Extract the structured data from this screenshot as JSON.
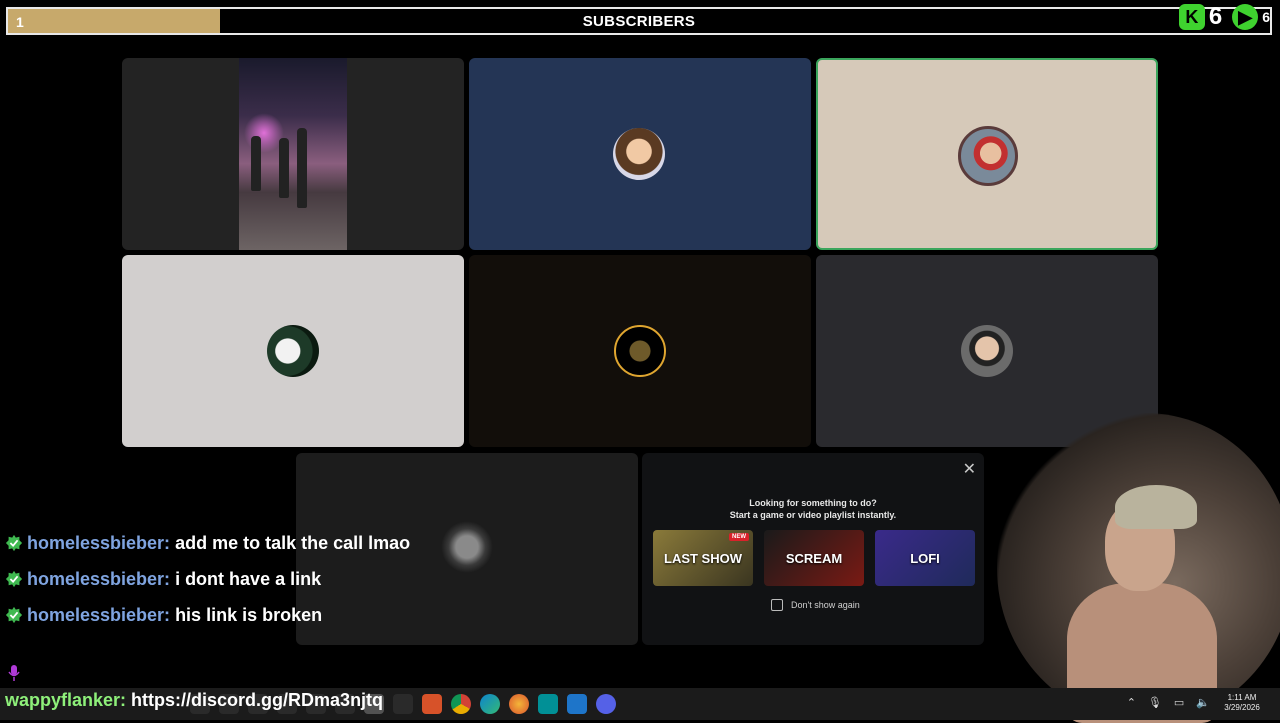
{
  "subscriber_bar": {
    "count": "1",
    "title": "SUBSCRIBERS",
    "progress_fraction": 0.168,
    "kick_count": "6",
    "rumble_count": "6"
  },
  "call": {
    "tiles": [
      {
        "name": "participant-video-street",
        "bg": "#232323"
      },
      {
        "name": "participant-austin",
        "bg": "#243555"
      },
      {
        "name": "participant-mario",
        "bg": "#d6c9b9",
        "speaking": true
      },
      {
        "name": "participant-joker",
        "bg": "#d2cfce"
      },
      {
        "name": "participant-gold-logo",
        "bg": "#120e0a"
      },
      {
        "name": "participant-sunglasses",
        "bg": "#2a2a2e"
      },
      {
        "name": "participant-screen",
        "bg": "#1c1c1c"
      }
    ]
  },
  "activity": {
    "heading_line1": "Looking for something to do?",
    "heading_line2": "Start a game or video playlist instantly.",
    "games": [
      {
        "label": "LAST SHOW",
        "badge": "NEW",
        "color": "#6b5a2e"
      },
      {
        "label": "SCREAM",
        "color": "#3a1212"
      },
      {
        "label": "LOFI",
        "color": "#34307a"
      }
    ],
    "dont_show": "Don't show again"
  },
  "chat": {
    "messages": [
      {
        "user": "homelessbieber:",
        "text": " add me to talk the call lmao"
      },
      {
        "user": "homelessbieber:",
        "text": " i dont have a link"
      },
      {
        "user": "homelessbieber:",
        "text": " his link is broken"
      }
    ],
    "overlay_user": "wappyflanker:",
    "overlay_text": " https://discord.gg/RDma3njtq"
  },
  "taskbar": {
    "time": "1:11 AM",
    "date": "3/29/2026",
    "icons": [
      "brave-icon",
      "chrome-icon",
      "edge-icon",
      "firefox-icon",
      "app-icon",
      "vscode-icon",
      "discord-icon"
    ]
  }
}
